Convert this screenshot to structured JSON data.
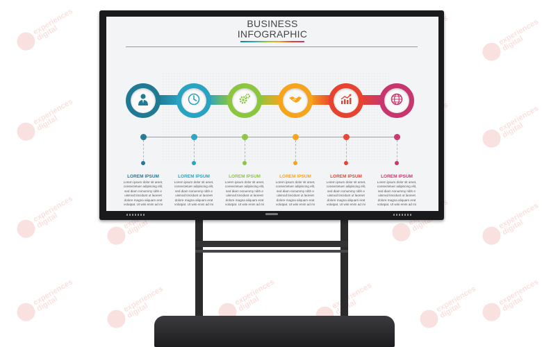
{
  "infographic": {
    "title_line1": "BUSINESS",
    "title_line2": "INFOGRAPHIC",
    "steps": [
      {
        "icon": "businessman-icon",
        "color": "#1f7a93",
        "heading": "LOREM IPSUM",
        "text": "Lorem ipsum dolor sit amet, consectetuer adipiscing elit, sed diam nonummy nibh e uismod tincidunt ut laoreet dolore magna aliquam erat volutpat. Ut wisi enim ad mi"
      },
      {
        "icon": "clock-icon",
        "color": "#2aa3c2",
        "heading": "LOREM IPSUM",
        "text": "Lorem ipsum dolor sit amet, consectetuer adipiscing elit, sed diam nonummy nibh e uismod tincidunt ut laoreet dolore magna aliquam erat volutpat. Ut wisi enim ad mi"
      },
      {
        "icon": "gears-icon",
        "color": "#8cc63f",
        "heading": "LOREM IPSUM",
        "text": "Lorem ipsum dolor sit amet, consectetuer adipiscing elit, sed diam nonummy nibh e uismod tincidunt ut laoreet dolore magna aliquam erat volutpat. Ut wisi enim ad mi"
      },
      {
        "icon": "handshake-icon",
        "color": "#f7a41d",
        "heading": "LOREM IPSUM",
        "text": "Lorem ipsum dolor sit amet, consectetuer adipiscing elit, sed diam nonummy nibh e uismod tincidunt ut laoreet dolore magna aliquam erat volutpat. Ut wisi enim ad mi"
      },
      {
        "icon": "growth-chart-icon",
        "color": "#e8432e",
        "heading": "LOREM IPSUM",
        "text": "Lorem ipsum dolor sit amet, consectetuer adipiscing elit, sed diam nonummy nibh e uismod tincidunt ut laoreet dolore magna aliquam erat volutpat. Ut wisi enim ad mi"
      },
      {
        "icon": "globe-icon",
        "color": "#c7366f",
        "heading": "LOREM IPSUM",
        "text": "Lorem ipsum dolor sit amet, consectetuer adipiscing elit, sed diam nonummy nibh e uismod tincidunt ut laoreet dolore magna aliquam erat volutpat. Ut wisi enim ad mi"
      }
    ]
  },
  "watermark": {
    "text_line1": "experiences",
    "text_line2": "digital"
  }
}
